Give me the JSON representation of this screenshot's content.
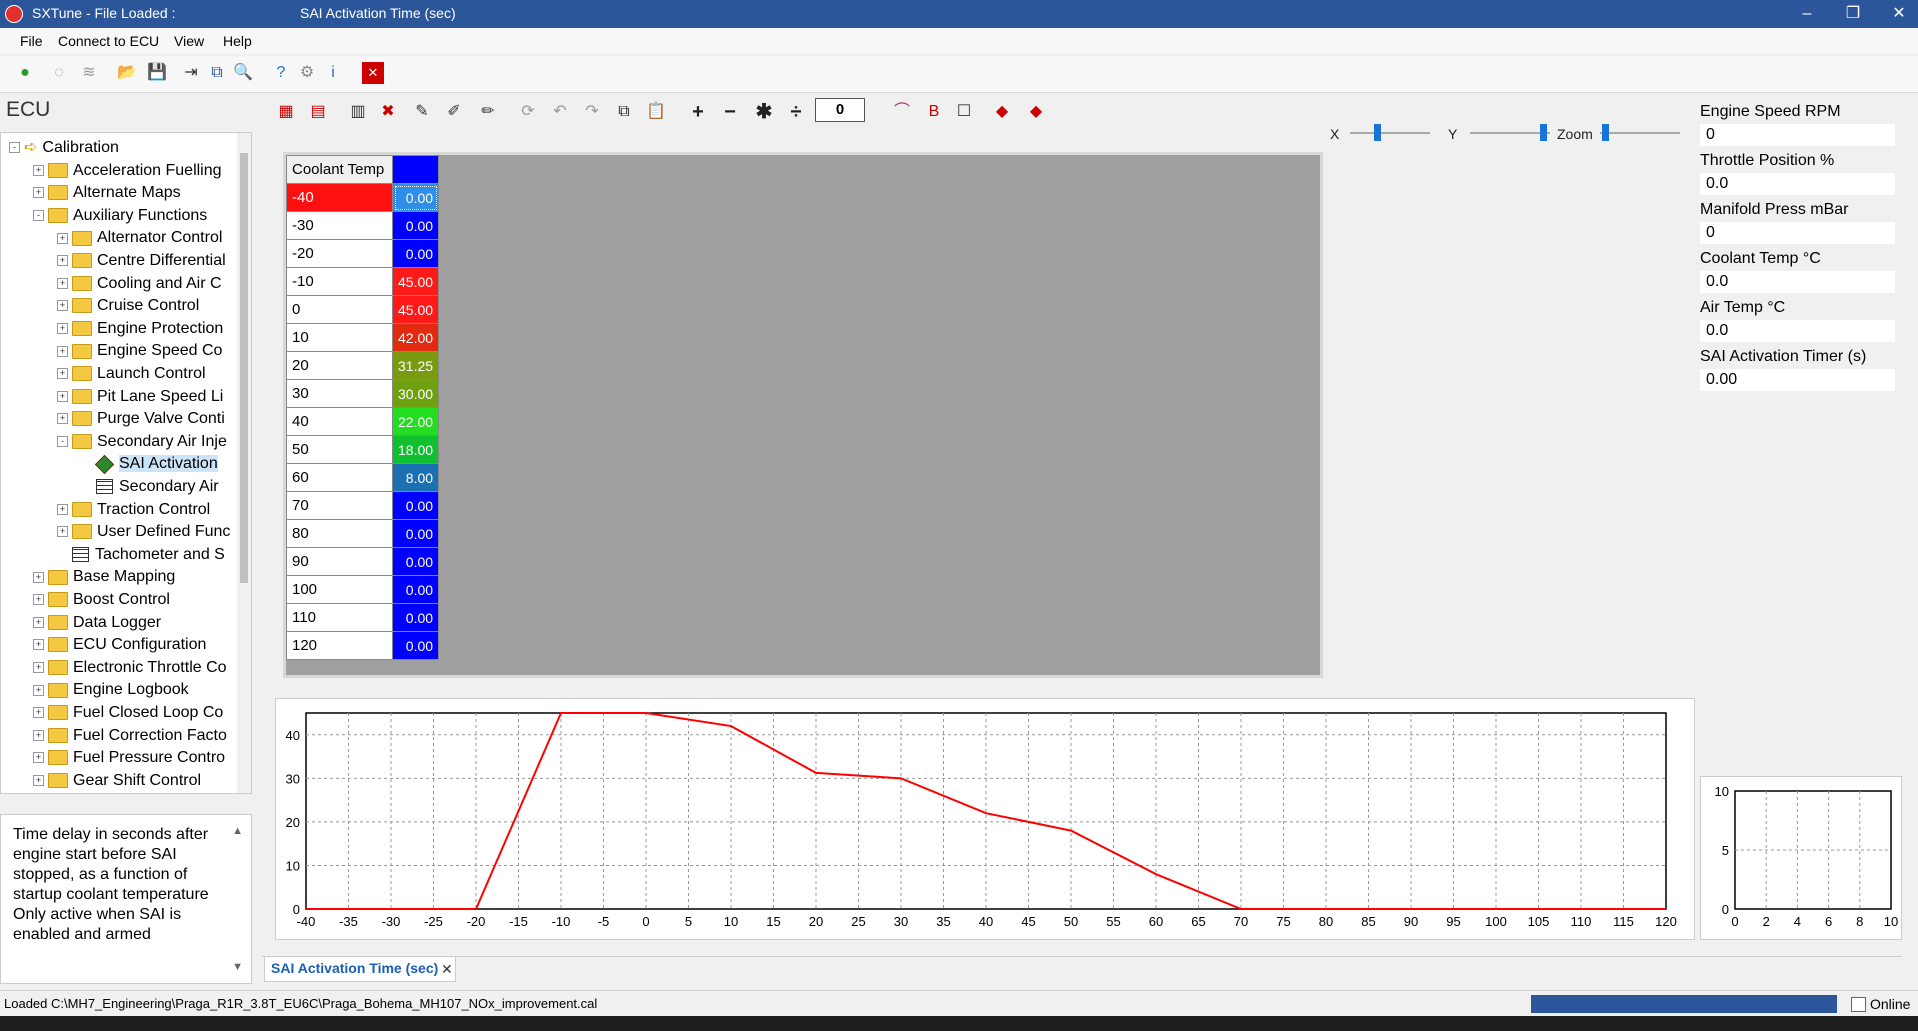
{
  "window": {
    "title": "SXTune - File Loaded :",
    "document": "SAI Activation Time (sec)",
    "controls": {
      "minimize": "–",
      "restore": "❐",
      "close": "✕"
    }
  },
  "menu": [
    "File",
    "Connect to ECU",
    "View",
    "Help"
  ],
  "toolbar": {
    "icons": [
      "go-icon",
      "disconnect-icon",
      "chart-icon",
      "open-folder-icon",
      "save-icon",
      "export-icon",
      "compare-icon",
      "search-icon",
      "help-icon",
      "settings-icon",
      "info-icon",
      "close-red-icon"
    ],
    "glyphs": [
      "●",
      "◌",
      "≋",
      "📂",
      "💾",
      "⇥",
      "⧉",
      "🔍",
      "?",
      "⚙",
      "i",
      "✕"
    ]
  },
  "left_panel": {
    "title": "ECU",
    "tree": [
      {
        "label": "Calibration",
        "indent": 0,
        "icon": "arrow",
        "expander": "-"
      },
      {
        "label": "Acceleration Fuelling",
        "indent": 1,
        "icon": "folder",
        "expander": "+"
      },
      {
        "label": "Alternate Maps",
        "indent": 1,
        "icon": "folder",
        "expander": "+"
      },
      {
        "label": "Auxiliary Functions",
        "indent": 1,
        "icon": "folder",
        "expander": "-"
      },
      {
        "label": "Alternator Control",
        "indent": 2,
        "icon": "folder",
        "expander": "+"
      },
      {
        "label": "Centre Differential",
        "indent": 2,
        "icon": "folder",
        "expander": "+"
      },
      {
        "label": "Cooling and Air C",
        "indent": 2,
        "icon": "folder",
        "expander": "+"
      },
      {
        "label": "Cruise Control",
        "indent": 2,
        "icon": "folder",
        "expander": "+"
      },
      {
        "label": "Engine Protection",
        "indent": 2,
        "icon": "folder",
        "expander": "+"
      },
      {
        "label": "Engine Speed Co",
        "indent": 2,
        "icon": "folder",
        "expander": "+"
      },
      {
        "label": "Launch Control",
        "indent": 2,
        "icon": "folder",
        "expander": "+"
      },
      {
        "label": "Pit Lane Speed Li",
        "indent": 2,
        "icon": "folder",
        "expander": "+"
      },
      {
        "label": "Purge Valve Conti",
        "indent": 2,
        "icon": "folder",
        "expander": "+"
      },
      {
        "label": "Secondary Air Inje",
        "indent": 2,
        "icon": "folder",
        "expander": "-"
      },
      {
        "label": "SAI Activation",
        "indent": 3,
        "icon": "cube",
        "expander": "",
        "selected": true
      },
      {
        "label": "Secondary Air",
        "indent": 3,
        "icon": "grid",
        "expander": ""
      },
      {
        "label": "Traction Control",
        "indent": 2,
        "icon": "folder",
        "expander": "+"
      },
      {
        "label": "User Defined Func",
        "indent": 2,
        "icon": "folder",
        "expander": "+"
      },
      {
        "label": "Tachometer and S",
        "indent": 2,
        "icon": "grid",
        "expander": ""
      },
      {
        "label": "Base Mapping",
        "indent": 1,
        "icon": "folder",
        "expander": "+"
      },
      {
        "label": "Boost Control",
        "indent": 1,
        "icon": "folder",
        "expander": "+"
      },
      {
        "label": "Data Logger",
        "indent": 1,
        "icon": "folder",
        "expander": "+"
      },
      {
        "label": "ECU Configuration",
        "indent": 1,
        "icon": "folder",
        "expander": "+"
      },
      {
        "label": "Electronic Throttle Co",
        "indent": 1,
        "icon": "folder",
        "expander": "+"
      },
      {
        "label": "Engine Logbook",
        "indent": 1,
        "icon": "folder",
        "expander": "+"
      },
      {
        "label": "Fuel Closed Loop Co",
        "indent": 1,
        "icon": "folder",
        "expander": "+"
      },
      {
        "label": "Fuel Correction Facto",
        "indent": 1,
        "icon": "folder",
        "expander": "+"
      },
      {
        "label": "Fuel Pressure Contro",
        "indent": 1,
        "icon": "folder",
        "expander": "+"
      },
      {
        "label": "Gear Shift Control",
        "indent": 1,
        "icon": "folder",
        "expander": "+"
      }
    ],
    "description": "Time delay in seconds after engine start before SAI stopped, as a function of startup coolant temperature Only active when SAI is enabled and armed"
  },
  "editor_toolbar": {
    "icons": [
      "cell-icon",
      "cell-red-icon",
      "columns-icon",
      "mark-icon",
      "pencil-icon",
      "pencil-alt-icon",
      "eraser-icon",
      "refresh-icon",
      "undo-icon",
      "redo-icon",
      "copy-icon",
      "paste-icon",
      "plus-icon",
      "minus-icon",
      "multiply-icon",
      "divide-icon"
    ],
    "glyphs": [
      "▦",
      "▤",
      "▥",
      "✖",
      "✎",
      "✐",
      "✏",
      "⟳",
      "↶",
      "↷",
      "⧉",
      "📋",
      "+",
      "−",
      "✱",
      "÷"
    ],
    "value_input": "0",
    "extra_icons": [
      "graph-icon",
      "flag-icon",
      "checkbox-icon",
      "cube-red-icon",
      "cube-alt-icon"
    ],
    "extra_glyphs": [
      "⌒",
      "B",
      "☐",
      "◆",
      "◆"
    ]
  },
  "sliders": {
    "x_label": "X",
    "y_label": "Y",
    "zoom_label": "Zoom"
  },
  "table": {
    "header": "Coolant Temp",
    "rows": [
      {
        "axis": "-40",
        "value": "0.00",
        "color": "#2f8fe8"
      },
      {
        "axis": "-30",
        "value": "0.00",
        "color": "#0000ff"
      },
      {
        "axis": "-20",
        "value": "0.00",
        "color": "#0000ff"
      },
      {
        "axis": "-10",
        "value": "45.00",
        "color": "#ff1a1a"
      },
      {
        "axis": "0",
        "value": "45.00",
        "color": "#ff1a1a"
      },
      {
        "axis": "10",
        "value": "42.00",
        "color": "#e22a10"
      },
      {
        "axis": "20",
        "value": "31.25",
        "color": "#7a9a10"
      },
      {
        "axis": "30",
        "value": "30.00",
        "color": "#6ea010"
      },
      {
        "axis": "40",
        "value": "22.00",
        "color": "#22dd22"
      },
      {
        "axis": "50",
        "value": "18.00",
        "color": "#10c030"
      },
      {
        "axis": "60",
        "value": "8.00",
        "color": "#1a70b0"
      },
      {
        "axis": "70",
        "value": "0.00",
        "color": "#0000ff"
      },
      {
        "axis": "80",
        "value": "0.00",
        "color": "#0000ff"
      },
      {
        "axis": "90",
        "value": "0.00",
        "color": "#0000ff"
      },
      {
        "axis": "100",
        "value": "0.00",
        "color": "#0000ff"
      },
      {
        "axis": "110",
        "value": "0.00",
        "color": "#0000ff"
      },
      {
        "axis": "120",
        "value": "0.00",
        "color": "#0000ff"
      }
    ]
  },
  "live_values": [
    {
      "label": "Engine Speed RPM",
      "value": "0"
    },
    {
      "label": "Throttle Position %",
      "value": "0.0"
    },
    {
      "label": "Manifold Press mBar",
      "value": "0"
    },
    {
      "label": "Coolant Temp °C",
      "value": "0.0"
    },
    {
      "label": "Air Temp °C",
      "value": "0.0"
    },
    {
      "label": "SAI Activation Timer (s)",
      "value": "0.00"
    }
  ],
  "chart_data": [
    {
      "type": "line",
      "x": [
        -40,
        -30,
        -20,
        -10,
        0,
        10,
        20,
        30,
        40,
        50,
        60,
        70,
        80,
        90,
        100,
        110,
        120
      ],
      "series": [
        {
          "values": [
            0,
            0,
            0,
            45,
            45,
            42,
            31.25,
            30,
            22,
            18,
            8,
            0,
            0,
            0,
            0,
            0,
            0
          ],
          "color": "#ff0000"
        }
      ],
      "xlim": [
        -40,
        120
      ],
      "ylim": [
        0,
        45
      ],
      "xticks": [
        -40,
        -35,
        -30,
        -25,
        -20,
        -15,
        -10,
        -5,
        0,
        5,
        10,
        15,
        20,
        25,
        30,
        35,
        40,
        45,
        50,
        55,
        60,
        65,
        70,
        75,
        80,
        85,
        90,
        95,
        100,
        105,
        110,
        115,
        120
      ],
      "yticks": [
        0,
        10,
        20,
        30,
        40
      ],
      "grid": true
    },
    {
      "type": "line",
      "x": [],
      "series": [],
      "xlim": [
        0,
        10
      ],
      "ylim": [
        0,
        10
      ],
      "xticks": [
        0,
        2,
        4,
        6,
        8,
        10
      ],
      "yticks": [
        0,
        5,
        10
      ],
      "grid": true
    }
  ],
  "tab": {
    "label": "SAI Activation Time (sec)",
    "close": "✕"
  },
  "status": {
    "text": "Loaded C:\\MH7_Engineering\\Praga_R1R_3.8T_EU6C\\Praga_Bohema_MH107_NOx_improvement.cal",
    "progress": 1.0,
    "online_label": "Online"
  }
}
